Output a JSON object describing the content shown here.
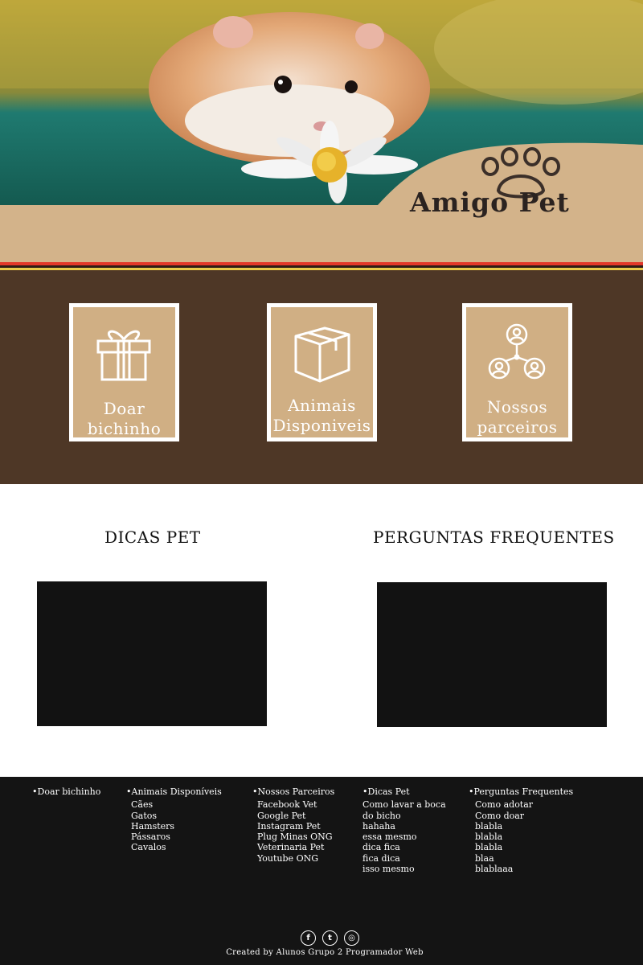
{
  "brand": {
    "name": "Amigo Pet"
  },
  "nav_cards": [
    {
      "label": "Doar bichinho",
      "icon": "gift-icon"
    },
    {
      "label": "Animais Disponiveis",
      "icon": "box-icon"
    },
    {
      "label": "Nossos parceiros",
      "icon": "partners-network-icon"
    }
  ],
  "sections": {
    "tips_title": "DICAS PET",
    "faq_title": "PERGUNTAS FREQUENTES"
  },
  "footer": {
    "columns": [
      {
        "heading": "Doar bichinho",
        "items": []
      },
      {
        "heading": "Animais Disponíveis",
        "items": [
          "Cães",
          "Gatos",
          "Hamsters",
          "Pássaros",
          "Cavalos"
        ]
      },
      {
        "heading": "Nossos Parceiros",
        "items": [
          "Facebook Vet",
          "Google Pet",
          "Instagram Pet",
          "Plug Minas ONG",
          "Veterinaria Pet",
          "Youtube ONG"
        ]
      },
      {
        "heading": "Dicas Pet",
        "items": [
          "Como lavar a boca",
          "do bicho",
          "hahaha",
          "essa mesmo",
          "dica fica",
          "fica dica",
          "isso mesmo"
        ]
      },
      {
        "heading": "Perguntas Frequentes",
        "items": [
          "Como adotar",
          "Como doar",
          "blabla",
          "blabla",
          "blabla",
          "blaa",
          "blablaaa"
        ]
      }
    ],
    "socials": [
      {
        "icon": "facebook-icon",
        "glyph": "f"
      },
      {
        "icon": "twitter-icon",
        "glyph": "t"
      },
      {
        "icon": "instagram-icon",
        "glyph": "◎"
      }
    ],
    "credit": "Created by Alunos Grupo 2 Programador Web"
  },
  "colors": {
    "tan": "#d3b38a",
    "brown": "#4e3726",
    "footer_bg": "#141414",
    "video_bg": "#121212"
  }
}
